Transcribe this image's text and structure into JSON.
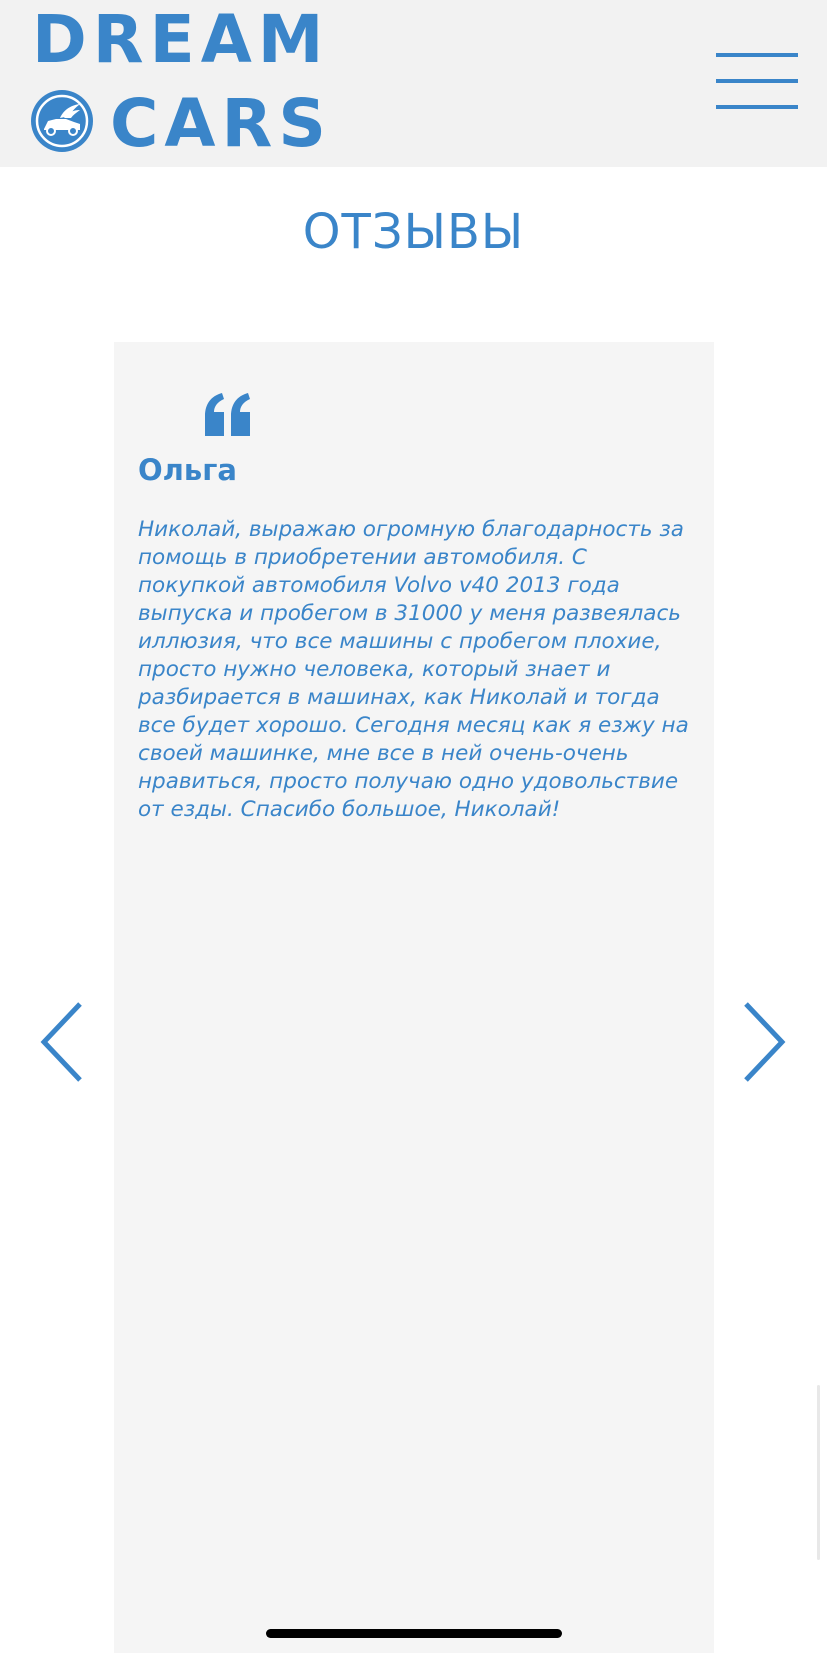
{
  "header": {
    "logo_line1": "DREAM",
    "logo_line2": "CARS",
    "logo_emblem_icon": "winged-car-emblem-icon",
    "menu_icon": "hamburger-menu-icon"
  },
  "section": {
    "title": "ОТЗЫВЫ"
  },
  "review": {
    "quote_icon": "quote-icon",
    "name": "Ольга",
    "text": "Николай, выражаю огромную благодарность за помощь в приобретении автомобиля. С покупкой автомобиля Volvo v40 2013 года выпуска и пробегом в 31000 у меня развеялась иллюзия, что все машины с пробегом плохие, просто нужно человека, который знает и разбирается в машинах, как Николай и тогда все будет хорошо. Сегодня месяц как я езжу на своей машинке, мне все в ней очень-очень нравиться, просто получаю одно удовольствие от езды. Спасибо большое, Николай!"
  },
  "carousel": {
    "prev_icon": "chevron-left-icon",
    "next_icon": "chevron-right-icon"
  },
  "colors": {
    "accent": "#3a85c9",
    "header_bg": "#f2f2f2",
    "card_bg": "#f5f5f5",
    "page_bg": "#ffffff"
  }
}
